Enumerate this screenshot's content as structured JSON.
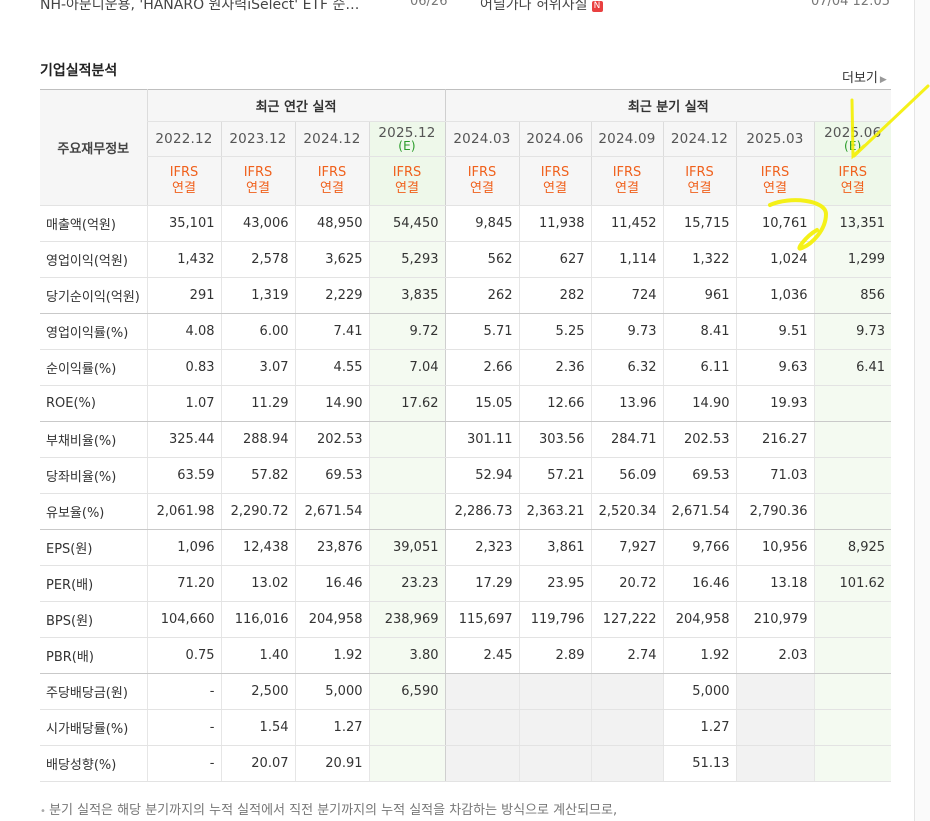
{
  "news": {
    "title": "NH-아문디운용, 'HANARO 원자력iSelect' ETF 순…",
    "date": "06/26",
    "source": "어닐가나 허위사실",
    "badge": "N",
    "time": "07/04 12:05"
  },
  "section": {
    "title": "기업실적분석",
    "more": "더보기"
  },
  "table": {
    "row_header": "주요재무정보",
    "annual_group": "최근 연간 실적",
    "quarter_group": "최근 분기 실적",
    "estimate_mark": "(E)",
    "periods": [
      {
        "label": "2022.12",
        "ifrs": "IFRS",
        "basis": "연결"
      },
      {
        "label": "2023.12",
        "ifrs": "IFRS",
        "basis": "연결"
      },
      {
        "label": "2024.12",
        "ifrs": "IFRS",
        "basis": "연결"
      },
      {
        "label": "2025.12",
        "ifrs": "IFRS",
        "basis": "연결"
      },
      {
        "label": "2024.03",
        "ifrs": "IFRS",
        "basis": "연결"
      },
      {
        "label": "2024.06",
        "ifrs": "IFRS",
        "basis": "연결"
      },
      {
        "label": "2024.09",
        "ifrs": "IFRS",
        "basis": "연결"
      },
      {
        "label": "2024.12",
        "ifrs": "IFRS",
        "basis": "연결"
      },
      {
        "label": "2025.03",
        "ifrs": "IFRS",
        "basis": "연결"
      },
      {
        "label": "2025.06",
        "ifrs": "IFRS",
        "basis": "연결"
      }
    ],
    "rows": [
      {
        "label": "매출액(억원)",
        "values": [
          "35,101",
          "43,006",
          "48,950",
          "54,450",
          "9,845",
          "11,938",
          "11,452",
          "15,715",
          "10,761",
          "13,351"
        ]
      },
      {
        "label": "영업이익(억원)",
        "values": [
          "1,432",
          "2,578",
          "3,625",
          "5,293",
          "562",
          "627",
          "1,114",
          "1,322",
          "1,024",
          "1,299"
        ]
      },
      {
        "label": "당기순이익(억원)",
        "values": [
          "291",
          "1,319",
          "2,229",
          "3,835",
          "262",
          "282",
          "724",
          "961",
          "1,036",
          "856"
        ]
      },
      {
        "label": "영업이익률(%)",
        "values": [
          "4.08",
          "6.00",
          "7.41",
          "9.72",
          "5.71",
          "5.25",
          "9.73",
          "8.41",
          "9.51",
          "9.73"
        ]
      },
      {
        "label": "순이익률(%)",
        "values": [
          "0.83",
          "3.07",
          "4.55",
          "7.04",
          "2.66",
          "2.36",
          "6.32",
          "6.11",
          "9.63",
          "6.41"
        ]
      },
      {
        "label": "ROE(%)",
        "values": [
          "1.07",
          "11.29",
          "14.90",
          "17.62",
          "15.05",
          "12.66",
          "13.96",
          "14.90",
          "19.93",
          ""
        ]
      },
      {
        "label": "부채비율(%)",
        "values": [
          "325.44",
          "288.94",
          "202.53",
          "",
          "301.11",
          "303.56",
          "284.71",
          "202.53",
          "216.27",
          ""
        ]
      },
      {
        "label": "당좌비율(%)",
        "values": [
          "63.59",
          "57.82",
          "69.53",
          "",
          "52.94",
          "57.21",
          "56.09",
          "69.53",
          "71.03",
          ""
        ]
      },
      {
        "label": "유보율(%)",
        "values": [
          "2,061.98",
          "2,290.72",
          "2,671.54",
          "",
          "2,286.73",
          "2,363.21",
          "2,520.34",
          "2,671.54",
          "2,790.36",
          ""
        ]
      },
      {
        "label": "EPS(원)",
        "values": [
          "1,096",
          "12,438",
          "23,876",
          "39,051",
          "2,323",
          "3,861",
          "7,927",
          "9,766",
          "10,956",
          "8,925"
        ]
      },
      {
        "label": "PER(배)",
        "values": [
          "71.20",
          "13.02",
          "16.46",
          "23.23",
          "17.29",
          "23.95",
          "20.72",
          "16.46",
          "13.18",
          "101.62"
        ]
      },
      {
        "label": "BPS(원)",
        "values": [
          "104,660",
          "116,016",
          "204,958",
          "238,969",
          "115,697",
          "119,796",
          "127,222",
          "204,958",
          "210,979",
          ""
        ]
      },
      {
        "label": "PBR(배)",
        "values": [
          "0.75",
          "1.40",
          "1.92",
          "3.80",
          "2.45",
          "2.89",
          "2.74",
          "1.92",
          "2.03",
          ""
        ]
      },
      {
        "label": "주당배당금(원)",
        "values": [
          "-",
          "2,500",
          "5,000",
          "6,590",
          "",
          "",
          "",
          "5,000",
          "",
          ""
        ]
      },
      {
        "label": "시가배당률(%)",
        "values": [
          "-",
          "1.54",
          "1.27",
          "",
          "",
          "",
          "",
          "1.27",
          "",
          ""
        ]
      },
      {
        "label": "배당성향(%)",
        "values": [
          "-",
          "20.07",
          "20.91",
          "",
          "",
          "",
          "",
          "51.13",
          "",
          ""
        ]
      }
    ]
  },
  "footnote": "분기 실적은 해당 분기까지의 누적 실적에서 직전 분기까지의 누적 실적을 차감하는 방식으로 계산되므로,",
  "colors": {
    "accent_orange": "#f0611d",
    "estimate_green": "#2a9c2a",
    "highlighter": "#f4f000"
  }
}
